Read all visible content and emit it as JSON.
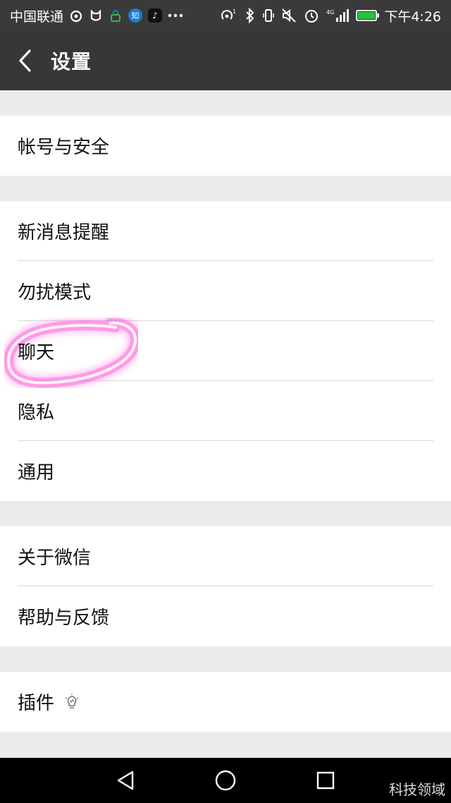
{
  "status_bar": {
    "carrier": "中国联通",
    "app_badge_zhi": "知",
    "time": "下午4:26",
    "network": "4G",
    "icons": [
      "weibo-icon",
      "cat-icon",
      "lock-icon",
      "zhihu-icon",
      "tiktok-icon",
      "more-icon",
      "hotspot-icon",
      "bluetooth-icon",
      "vibrate-icon",
      "mute-icon",
      "alarm-icon",
      "signal-icon",
      "battery-icon"
    ],
    "battery_color": "#2fbf3f"
  },
  "header": {
    "title": "设置",
    "background": "#373737"
  },
  "groups": [
    {
      "items": [
        {
          "label": "帐号与安全"
        }
      ]
    },
    {
      "items": [
        {
          "label": "新消息提醒"
        },
        {
          "label": "勿扰模式"
        },
        {
          "label": "聊天"
        },
        {
          "label": "隐私"
        },
        {
          "label": "通用"
        }
      ]
    },
    {
      "items": [
        {
          "label": "关于微信"
        },
        {
          "label": "帮助与反馈"
        }
      ]
    },
    {
      "items": [
        {
          "label": "插件",
          "icon": "bulb-icon"
        }
      ]
    }
  ],
  "annotation": {
    "highlight_color": "#ff3ccf",
    "highlighted_item": "聊天"
  },
  "nav_bar": {
    "icons": [
      "back-triangle-icon",
      "home-circle-icon",
      "recents-square-icon"
    ]
  },
  "watermark": "科技领域"
}
